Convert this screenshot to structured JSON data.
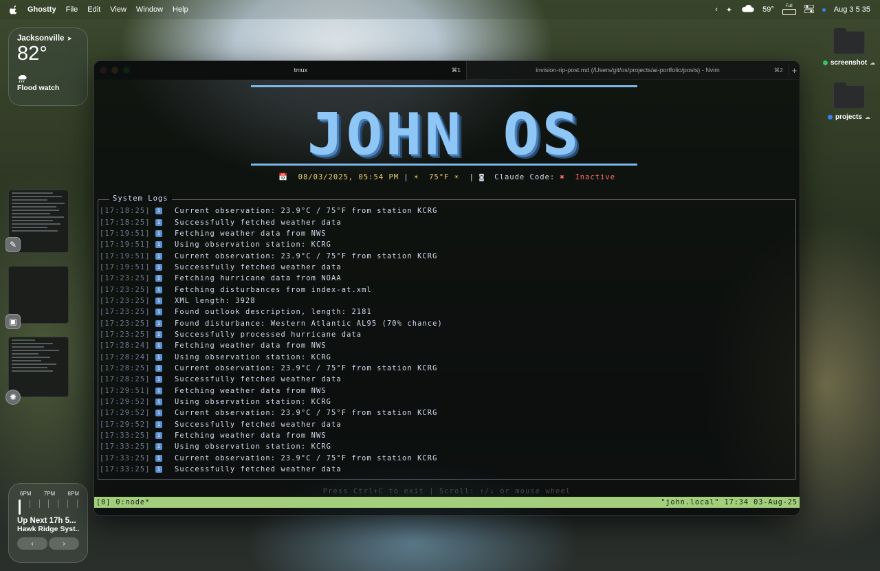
{
  "menubar": {
    "app_name": "Ghostty",
    "menus": [
      "File",
      "Edit",
      "View",
      "Window",
      "Help"
    ],
    "temperature": "59°",
    "battery_label": "Full",
    "datetime": "Aug 3  5 35"
  },
  "weather_widget": {
    "city": "Jacksonville",
    "temperature": "82°",
    "condition": "Flood watch"
  },
  "calendar_widget": {
    "hours": [
      "6PM",
      "7PM",
      "8PM"
    ],
    "next_label": "Up Next 17h 5...",
    "event": "Hawk Ridge Syst...",
    "prev_glyph": "‹",
    "next_glyph": "›"
  },
  "desktop": {
    "folders": [
      {
        "label": "screenshot",
        "dot_color": "#34c759"
      },
      {
        "label": "projects",
        "dot_color": "#3b82f6"
      }
    ]
  },
  "window": {
    "tabs": [
      {
        "title": "tmux",
        "shortcut": "⌘1"
      },
      {
        "title": "invision-rip-post.md (/Users/git/os/projects/ai-portfolio/posts) - Nvim",
        "shortcut": "⌘2"
      }
    ],
    "new_tab_glyph": "+"
  },
  "terminal": {
    "banner": "JOHN OS",
    "status": {
      "datetime": "08/03/2025, 05:54 PM",
      "weather": "75°F",
      "claude_label": "Claude Code:",
      "claude_state": "Inactive"
    },
    "logs_title": "System Logs",
    "logs": [
      {
        "time": "[17:18:25]",
        "msg": "Current observation: 23.9°C / 75°F from station KCRG"
      },
      {
        "time": "[17:18:25]",
        "msg": "Successfully fetched weather data"
      },
      {
        "time": "[17:19:51]",
        "msg": "Fetching weather data from NWS"
      },
      {
        "time": "[17:19:51]",
        "msg": "Using observation station: KCRG"
      },
      {
        "time": "[17:19:51]",
        "msg": "Current observation: 23.9°C / 75°F from station KCRG"
      },
      {
        "time": "[17:19:51]",
        "msg": "Successfully fetched weather data"
      },
      {
        "time": "[17:23:25]",
        "msg": "Fetching hurricane data from NOAA"
      },
      {
        "time": "[17:23:25]",
        "msg": "Fetching disturbances from index-at.xml"
      },
      {
        "time": "[17:23:25]",
        "msg": "XML length: 3928"
      },
      {
        "time": "[17:23:25]",
        "msg": "Found outlook description, length: 2181"
      },
      {
        "time": "[17:23:25]",
        "msg": "Found disturbance: Western Atlantic AL95 (70% chance)"
      },
      {
        "time": "[17:23:25]",
        "msg": "Successfully processed hurricane data"
      },
      {
        "time": "[17:28:24]",
        "msg": "Fetching weather data from NWS"
      },
      {
        "time": "[17:28:24]",
        "msg": "Using observation station: KCRG"
      },
      {
        "time": "[17:28:25]",
        "msg": "Current observation: 23.9°C / 75°F from station KCRG"
      },
      {
        "time": "[17:28:25]",
        "msg": "Successfully fetched weather data"
      },
      {
        "time": "[17:29:51]",
        "msg": "Fetching weather data from NWS"
      },
      {
        "time": "[17:29:52]",
        "msg": "Using observation station: KCRG"
      },
      {
        "time": "[17:29:52]",
        "msg": "Current observation: 23.9°C / 75°F from station KCRG"
      },
      {
        "time": "[17:29:52]",
        "msg": "Successfully fetched weather data"
      },
      {
        "time": "[17:33:25]",
        "msg": "Fetching weather data from NWS"
      },
      {
        "time": "[17:33:25]",
        "msg": "Using observation station: KCRG"
      },
      {
        "time": "[17:33:25]",
        "msg": "Current observation: 23.9°C / 75°F from station KCRG"
      },
      {
        "time": "[17:33:25]",
        "msg": "Successfully fetched weather data"
      }
    ],
    "hint": "Press Ctrl+C to exit | Scroll: ↑/↓ or mouse wheel",
    "tmux_left": "[0] 0:node*",
    "tmux_right": "\"john.local\" 17:34 03-Aug-25"
  },
  "colors": {
    "accent_blue": "#8ec6f5",
    "tmux_green": "#a3cf7c",
    "inactive_red": "#ff6b6b"
  }
}
